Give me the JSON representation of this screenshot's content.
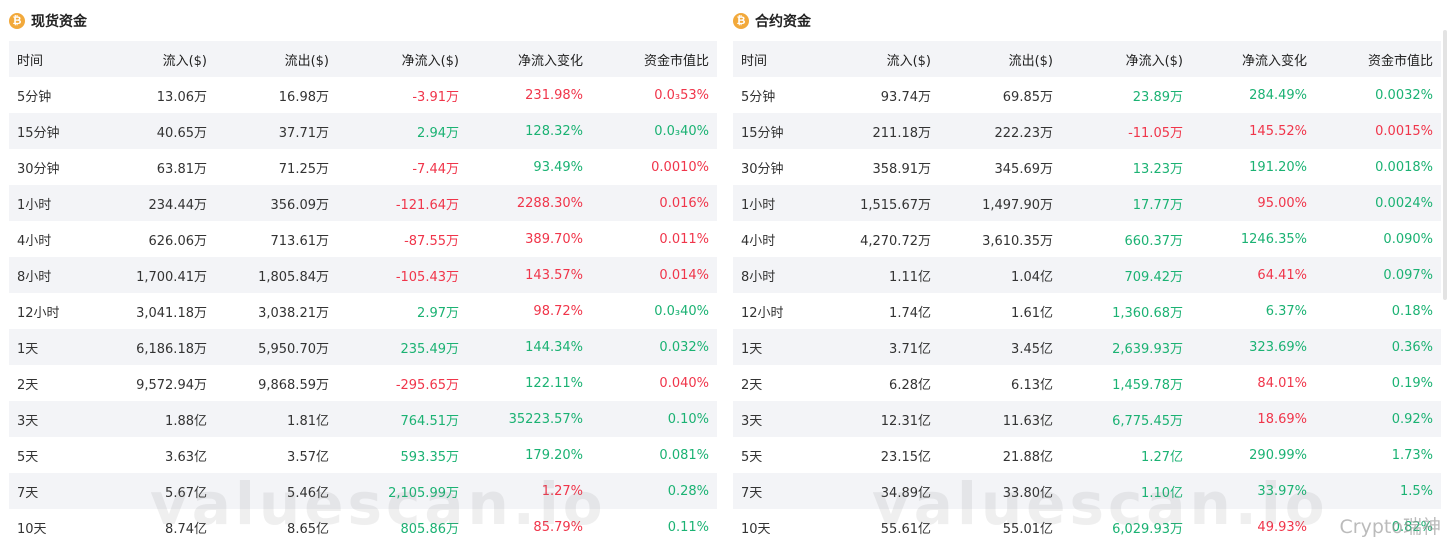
{
  "spot": {
    "title": "现货资金",
    "headers": [
      "时间",
      "流入($)",
      "流出($)",
      "净流入($)",
      "净流入变化",
      "资金市值比"
    ],
    "rows": [
      {
        "time": "5分钟",
        "inflow": "13.06万",
        "outflow": "16.98万",
        "net": "-3.91万",
        "net_dir": "neg",
        "change": "231.98%",
        "change_dir": "neg",
        "ratio": "0.0₃53%",
        "ratio_dir": "neg"
      },
      {
        "time": "15分钟",
        "inflow": "40.65万",
        "outflow": "37.71万",
        "net": "2.94万",
        "net_dir": "pos",
        "change": "128.32%",
        "change_dir": "pos",
        "ratio": "0.0₃40%",
        "ratio_dir": "pos"
      },
      {
        "time": "30分钟",
        "inflow": "63.81万",
        "outflow": "71.25万",
        "net": "-7.44万",
        "net_dir": "neg",
        "change": "93.49%",
        "change_dir": "pos",
        "ratio": "0.0010%",
        "ratio_dir": "neg"
      },
      {
        "time": "1小时",
        "inflow": "234.44万",
        "outflow": "356.09万",
        "net": "-121.64万",
        "net_dir": "neg",
        "change": "2288.30%",
        "change_dir": "neg",
        "ratio": "0.016%",
        "ratio_dir": "neg"
      },
      {
        "time": "4小时",
        "inflow": "626.06万",
        "outflow": "713.61万",
        "net": "-87.55万",
        "net_dir": "neg",
        "change": "389.70%",
        "change_dir": "neg",
        "ratio": "0.011%",
        "ratio_dir": "neg"
      },
      {
        "time": "8小时",
        "inflow": "1,700.41万",
        "outflow": "1,805.84万",
        "net": "-105.43万",
        "net_dir": "neg",
        "change": "143.57%",
        "change_dir": "neg",
        "ratio": "0.014%",
        "ratio_dir": "neg"
      },
      {
        "time": "12小时",
        "inflow": "3,041.18万",
        "outflow": "3,038.21万",
        "net": "2.97万",
        "net_dir": "pos",
        "change": "98.72%",
        "change_dir": "neg",
        "ratio": "0.0₃40%",
        "ratio_dir": "pos"
      },
      {
        "time": "1天",
        "inflow": "6,186.18万",
        "outflow": "5,950.70万",
        "net": "235.49万",
        "net_dir": "pos",
        "change": "144.34%",
        "change_dir": "pos",
        "ratio": "0.032%",
        "ratio_dir": "pos"
      },
      {
        "time": "2天",
        "inflow": "9,572.94万",
        "outflow": "9,868.59万",
        "net": "-295.65万",
        "net_dir": "neg",
        "change": "122.11%",
        "change_dir": "pos",
        "ratio": "0.040%",
        "ratio_dir": "neg"
      },
      {
        "time": "3天",
        "inflow": "1.88亿",
        "outflow": "1.81亿",
        "net": "764.51万",
        "net_dir": "pos",
        "change": "35223.57%",
        "change_dir": "pos",
        "ratio": "0.10%",
        "ratio_dir": "pos"
      },
      {
        "time": "5天",
        "inflow": "3.63亿",
        "outflow": "3.57亿",
        "net": "593.35万",
        "net_dir": "pos",
        "change": "179.20%",
        "change_dir": "pos",
        "ratio": "0.081%",
        "ratio_dir": "pos"
      },
      {
        "time": "7天",
        "inflow": "5.67亿",
        "outflow": "5.46亿",
        "net": "2,105.99万",
        "net_dir": "pos",
        "change": "1.27%",
        "change_dir": "neg",
        "ratio": "0.28%",
        "ratio_dir": "pos"
      },
      {
        "time": "10天",
        "inflow": "8.74亿",
        "outflow": "8.65亿",
        "net": "805.86万",
        "net_dir": "pos",
        "change": "85.79%",
        "change_dir": "neg",
        "ratio": "0.11%",
        "ratio_dir": "pos"
      }
    ]
  },
  "futures": {
    "title": "合约资金",
    "headers": [
      "时间",
      "流入($)",
      "流出($)",
      "净流入($)",
      "净流入变化",
      "资金市值比"
    ],
    "rows": [
      {
        "time": "5分钟",
        "inflow": "93.74万",
        "outflow": "69.85万",
        "net": "23.89万",
        "net_dir": "pos",
        "change": "284.49%",
        "change_dir": "pos",
        "ratio": "0.0032%",
        "ratio_dir": "pos"
      },
      {
        "time": "15分钟",
        "inflow": "211.18万",
        "outflow": "222.23万",
        "net": "-11.05万",
        "net_dir": "neg",
        "change": "145.52%",
        "change_dir": "neg",
        "ratio": "0.0015%",
        "ratio_dir": "neg"
      },
      {
        "time": "30分钟",
        "inflow": "358.91万",
        "outflow": "345.69万",
        "net": "13.23万",
        "net_dir": "pos",
        "change": "191.20%",
        "change_dir": "pos",
        "ratio": "0.0018%",
        "ratio_dir": "pos"
      },
      {
        "time": "1小时",
        "inflow": "1,515.67万",
        "outflow": "1,497.90万",
        "net": "17.77万",
        "net_dir": "pos",
        "change": "95.00%",
        "change_dir": "neg",
        "ratio": "0.0024%",
        "ratio_dir": "pos"
      },
      {
        "time": "4小时",
        "inflow": "4,270.72万",
        "outflow": "3,610.35万",
        "net": "660.37万",
        "net_dir": "pos",
        "change": "1246.35%",
        "change_dir": "pos",
        "ratio": "0.090%",
        "ratio_dir": "pos"
      },
      {
        "time": "8小时",
        "inflow": "1.11亿",
        "outflow": "1.04亿",
        "net": "709.42万",
        "net_dir": "pos",
        "change": "64.41%",
        "change_dir": "neg",
        "ratio": "0.097%",
        "ratio_dir": "pos"
      },
      {
        "time": "12小时",
        "inflow": "1.74亿",
        "outflow": "1.61亿",
        "net": "1,360.68万",
        "net_dir": "pos",
        "change": "6.37%",
        "change_dir": "pos",
        "ratio": "0.18%",
        "ratio_dir": "pos"
      },
      {
        "time": "1天",
        "inflow": "3.71亿",
        "outflow": "3.45亿",
        "net": "2,639.93万",
        "net_dir": "pos",
        "change": "323.69%",
        "change_dir": "pos",
        "ratio": "0.36%",
        "ratio_dir": "pos"
      },
      {
        "time": "2天",
        "inflow": "6.28亿",
        "outflow": "6.13亿",
        "net": "1,459.78万",
        "net_dir": "pos",
        "change": "84.01%",
        "change_dir": "neg",
        "ratio": "0.19%",
        "ratio_dir": "pos"
      },
      {
        "time": "3天",
        "inflow": "12.31亿",
        "outflow": "11.63亿",
        "net": "6,775.45万",
        "net_dir": "pos",
        "change": "18.69%",
        "change_dir": "neg",
        "ratio": "0.92%",
        "ratio_dir": "pos"
      },
      {
        "time": "5天",
        "inflow": "23.15亿",
        "outflow": "21.88亿",
        "net": "1.27亿",
        "net_dir": "pos",
        "change": "290.99%",
        "change_dir": "pos",
        "ratio": "1.73%",
        "ratio_dir": "pos"
      },
      {
        "time": "7天",
        "inflow": "34.89亿",
        "outflow": "33.80亿",
        "net": "1.10亿",
        "net_dir": "pos",
        "change": "33.97%",
        "change_dir": "pos",
        "ratio": "1.5%",
        "ratio_dir": "pos"
      },
      {
        "time": "10天",
        "inflow": "55.61亿",
        "outflow": "55.01亿",
        "net": "6,029.93万",
        "net_dir": "pos",
        "change": "49.93%",
        "change_dir": "neg",
        "ratio": "0.82%",
        "ratio_dir": "pos"
      }
    ]
  },
  "watermark": "valuescan.io",
  "badge": "Crypto瑞神",
  "colors": {
    "positive": "#1bb273",
    "negative": "#f0354a",
    "stripe": "#f3f4f7",
    "coin": "#f2a93b"
  },
  "icons": {
    "panel_icon": "coin-icon"
  }
}
